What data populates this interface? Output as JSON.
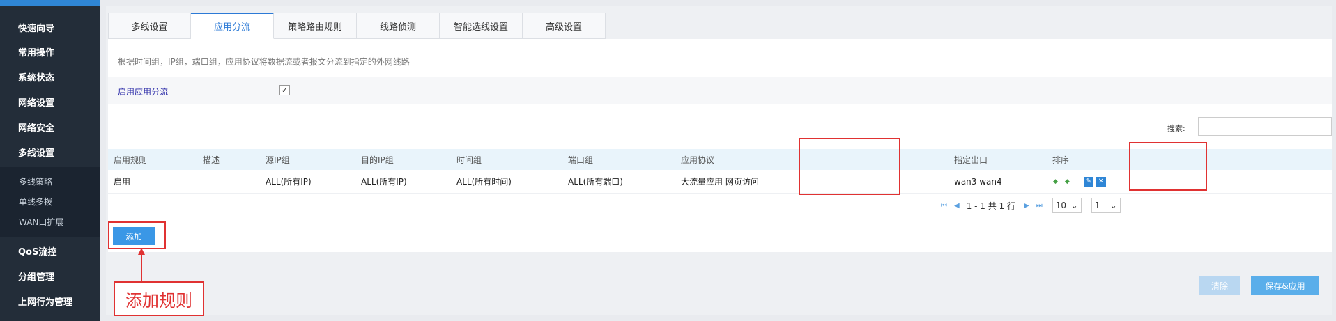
{
  "sidebar": {
    "items": [
      {
        "label": "快速向导"
      },
      {
        "label": "常用操作"
      },
      {
        "label": "系统状态"
      },
      {
        "label": "网络设置"
      },
      {
        "label": "网络安全"
      },
      {
        "label": "多线设置"
      },
      {
        "label": "QoS流控"
      },
      {
        "label": "分组管理"
      },
      {
        "label": "上网行为管理"
      }
    ],
    "subitems": [
      {
        "label": "多线策略"
      },
      {
        "label": "单线多拨"
      },
      {
        "label": "WAN口扩展"
      }
    ]
  },
  "tabs": [
    {
      "label": "多线设置"
    },
    {
      "label": "应用分流"
    },
    {
      "label": "策略路由规则"
    },
    {
      "label": "线路侦测"
    },
    {
      "label": "智能选线设置"
    },
    {
      "label": "高级设置"
    }
  ],
  "active_tab": "应用分流",
  "description": "根据时间组，IP组，端口组，应用协议将数据流或者报文分流到指定的外网线路",
  "enable": {
    "label": "启用应用分流",
    "checked": true,
    "check_glyph": "✓"
  },
  "search": {
    "label": "搜索:",
    "value": ""
  },
  "table": {
    "headers": {
      "enable": "启用规则",
      "desc": "描述",
      "src_ip": "源IP组",
      "dst_ip": "目的IP组",
      "time": "时间组",
      "port": "端口组",
      "app": "应用协议",
      "exit": "指定出口",
      "sort": "排序"
    },
    "rows": [
      {
        "enable": "启用",
        "desc": "-",
        "src_ip": "ALL(所有IP)",
        "dst_ip": "ALL(所有IP)",
        "time": "ALL(所有时间)",
        "port": "ALL(所有端口)",
        "app": "大流量应用 网页访问",
        "exit": "wan3 wan4"
      }
    ]
  },
  "pager": {
    "info": "1 - 1 共 1 行",
    "page_size": "10",
    "page": "1"
  },
  "buttons": {
    "add": "添加",
    "clear": "清除",
    "save": "保存&应用"
  },
  "annotation": {
    "label": "添加规则",
    "color": "#e03232"
  },
  "colors": {
    "sidebar_bg": "#232d39",
    "accent": "#2f86d6",
    "header_bg": "#e9f4fb",
    "highlight": "#e03232"
  }
}
